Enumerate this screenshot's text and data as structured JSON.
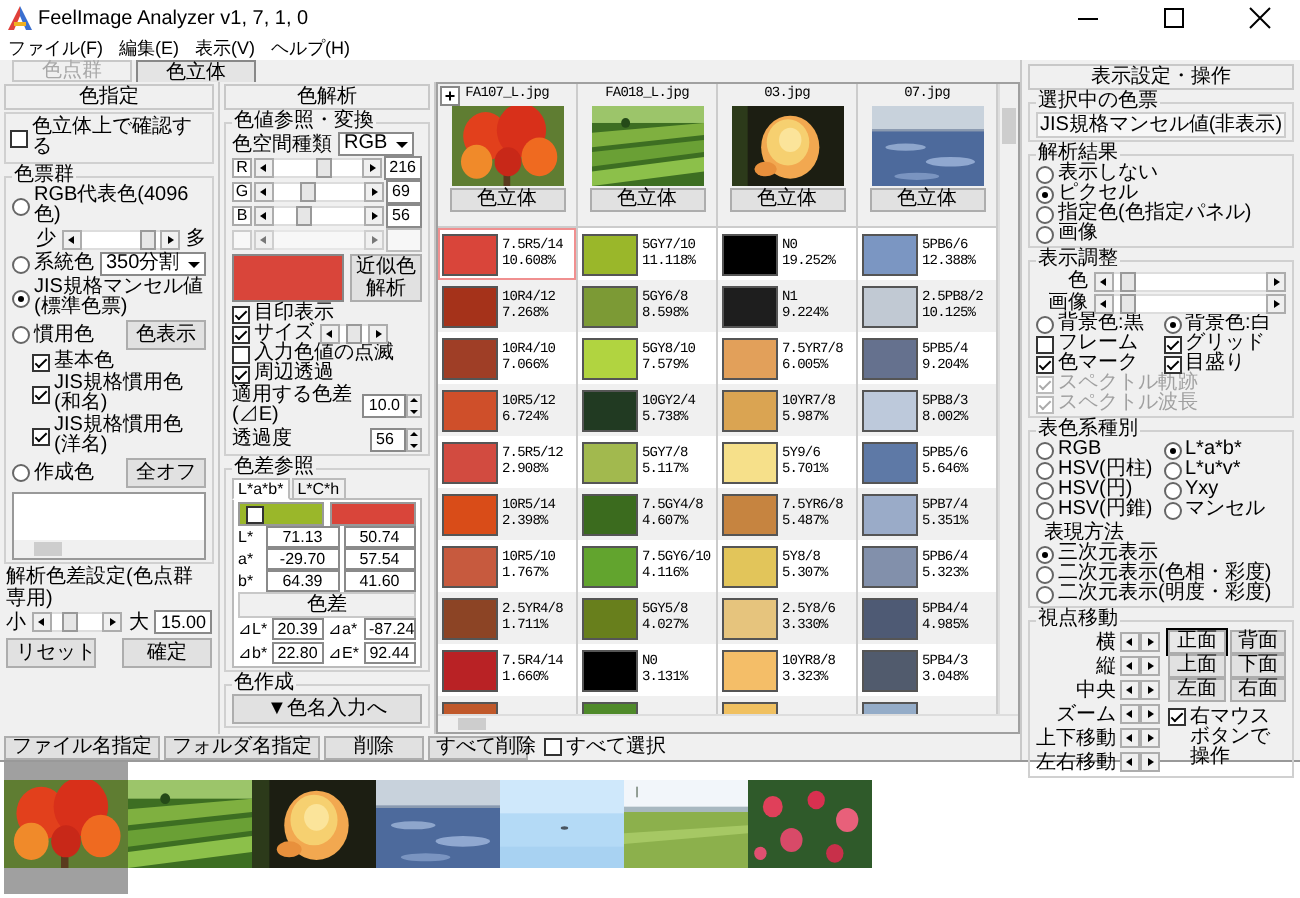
{
  "window": {
    "title": "FeelImage Analyzer v1, 7, 1, 0"
  },
  "menu": [
    "ファイル(F)",
    "編集(E)",
    "表示(V)",
    "ヘルプ(H)"
  ],
  "tabs": [
    {
      "label": "色点群",
      "selected": false,
      "disabled": true
    },
    {
      "label": "色立体",
      "selected": true,
      "disabled": false
    }
  ],
  "color_spec_panel": {
    "title": "色指定",
    "confirm_on_solid": {
      "label": "色立体上で確認する",
      "checked": false
    },
    "swatch_group": {
      "title": "色票群",
      "items": [
        {
          "kind": "radio-slider",
          "label": "RGB代表色(4096色)",
          "selected": false,
          "min_label": "少",
          "max_label": "多",
          "level": 0.92
        },
        {
          "kind": "radio-dropdown",
          "label": "系統色",
          "selected": false,
          "value": "350分割"
        },
        {
          "kind": "radio",
          "label": "JIS規格マンセル値(標準色票)",
          "selected": true
        },
        {
          "kind": "radio-button",
          "label": "慣用色",
          "selected": false,
          "button": "色表示"
        },
        {
          "kind": "checkbox",
          "label": "基本色",
          "checked": true
        },
        {
          "kind": "checkbox",
          "label": "JIS規格慣用色(和名)",
          "checked": true
        },
        {
          "kind": "checkbox",
          "label": "JIS規格慣用色(洋名)",
          "checked": true
        },
        {
          "kind": "radio-button",
          "label": "作成色",
          "selected": false,
          "button": "全オフ"
        }
      ]
    },
    "delta_setting": {
      "title": "解析色差設定(色点群専用)",
      "min_label": "小",
      "max_label": "大",
      "level": 0.3,
      "value": "15.00"
    },
    "buttons": [
      "リセット",
      "確定"
    ]
  },
  "analysis_panel": {
    "title": "色解析",
    "convert_group": {
      "title": "色値参照・変換",
      "space_label": "色空間種類",
      "space": "RGB",
      "channels": [
        {
          "name": "R",
          "level": 0.6,
          "value": "216"
        },
        {
          "name": "G",
          "level": 0.35,
          "value": "69"
        },
        {
          "name": "B",
          "level": 0.3,
          "value": "56"
        }
      ],
      "swatch": {
        "color": "#d9453a"
      },
      "analyze_button": "近似色解析",
      "options": [
        {
          "kind": "checkbox",
          "label": "目印表示",
          "checked": true
        },
        {
          "kind": "checkbox-slider",
          "label": "サイズ",
          "checked": true,
          "level": 0.45
        },
        {
          "kind": "checkbox",
          "label": "入力色値の点滅",
          "checked": false
        },
        {
          "kind": "checkbox",
          "label": "周辺透過",
          "checked": true
        },
        {
          "kind": "spinner",
          "label": "適用する色差(⊿E)",
          "value": "10.0"
        },
        {
          "kind": "spinner",
          "label": "透過度",
          "value": "56"
        }
      ]
    },
    "diff_group": {
      "title": "色差参照",
      "tabs": [
        {
          "label": "L*a*b*",
          "selected": true
        },
        {
          "label": "L*C*h",
          "selected": false
        }
      ],
      "swatches": [
        {
          "color": "#9ab72a",
          "checked": false
        },
        {
          "color": "#d9453a"
        }
      ],
      "rows": [
        {
          "label": "L*",
          "values": [
            "71.13",
            "50.74"
          ]
        },
        {
          "label": "a*",
          "values": [
            "-29.70",
            "57.54"
          ]
        },
        {
          "label": "b*",
          "values": [
            "64.39",
            "41.60"
          ]
        }
      ],
      "diff_title": "色差",
      "diffs": [
        {
          "label": "⊿L*",
          "value": "20.39"
        },
        {
          "label": "⊿a*",
          "value": "-87.24"
        },
        {
          "label": "⊿b*",
          "value": "22.80"
        },
        {
          "label": "⊿E*",
          "value": "92.44"
        }
      ]
    },
    "create_group": {
      "title": "色作成",
      "button": "▼色名入力へ"
    }
  },
  "grid": {
    "expand_button": "+",
    "columns": [
      {
        "file": "FA107_L.jpg",
        "button": "色立体",
        "cells": [
          {
            "color": "#d9453a",
            "label": "7.5R5/14",
            "percent": "10.608%",
            "selected": true
          },
          {
            "color": "#a5321a",
            "label": "10R4/12",
            "percent": "7.268%",
            "selected": false
          },
          {
            "color": "#9f3e26",
            "label": "10R4/10",
            "percent": "7.066%",
            "selected": false
          },
          {
            "color": "#cf4f2a",
            "label": "10R5/12",
            "percent": "6.724%",
            "selected": false
          },
          {
            "color": "#d24b40",
            "label": "7.5R5/12",
            "percent": "2.908%",
            "selected": false
          },
          {
            "color": "#d94c18",
            "label": "10R5/14",
            "percent": "2.398%",
            "selected": false
          },
          {
            "color": "#c75a3e",
            "label": "10R5/10",
            "percent": "1.767%",
            "selected": false
          },
          {
            "color": "#8c4425",
            "label": "2.5YR4/8",
            "percent": "1.711%",
            "selected": false
          },
          {
            "color": "#b92225",
            "label": "7.5R4/14",
            "percent": "1.660%",
            "selected": false
          },
          {
            "color": "#c0582a",
            "selected": false
          }
        ]
      },
      {
        "file": "FA018_L.jpg",
        "button": "色立体",
        "cells": [
          {
            "color": "#9ab72a",
            "label": "5GY7/10",
            "percent": "11.118%",
            "selected": false
          },
          {
            "color": "#7c9a35",
            "label": "5GY6/8",
            "percent": "8.598%",
            "selected": false
          },
          {
            "color": "#b1d440",
            "label": "5GY8/10",
            "percent": "7.579%",
            "selected": false
          },
          {
            "color": "#213a22",
            "label": "10GY2/4",
            "percent": "5.738%",
            "selected": false
          },
          {
            "color": "#a2b94e",
            "label": "5GY7/8",
            "percent": "5.117%",
            "selected": false
          },
          {
            "color": "#3b6b1e",
            "label": "7.5GY4/8",
            "percent": "4.607%",
            "selected": false
          },
          {
            "color": "#62a42e",
            "label": "7.5GY6/10",
            "percent": "4.116%",
            "selected": false
          },
          {
            "color": "#687f1c",
            "label": "5GY5/8",
            "percent": "4.027%",
            "selected": false
          },
          {
            "color": "#000000",
            "label": "N0",
            "percent": "3.131%",
            "selected": false
          },
          {
            "color": "#4f8a2a",
            "selected": false
          }
        ]
      },
      {
        "file": "03.jpg",
        "button": "色立体",
        "cells": [
          {
            "color": "#000000",
            "label": "N0",
            "percent": "19.252%",
            "selected": false
          },
          {
            "color": "#1e1e1e",
            "label": "N1",
            "percent": "9.224%",
            "selected": false
          },
          {
            "color": "#e2a05a",
            "label": "7.5YR7/8",
            "percent": "6.005%",
            "selected": false
          },
          {
            "color": "#daa452",
            "label": "10YR7/8",
            "percent": "5.987%",
            "selected": false
          },
          {
            "color": "#f6e08a",
            "label": "5Y9/6",
            "percent": "5.701%",
            "selected": false
          },
          {
            "color": "#c68440",
            "label": "7.5YR6/8",
            "percent": "5.487%",
            "selected": false
          },
          {
            "color": "#e2c55a",
            "label": "5Y8/8",
            "percent": "5.307%",
            "selected": false
          },
          {
            "color": "#e6c47d",
            "label": "2.5Y8/6",
            "percent": "3.330%",
            "selected": false
          },
          {
            "color": "#f4be68",
            "label": "10YR8/8",
            "percent": "3.323%",
            "selected": false
          },
          {
            "color": "#f0c060",
            "selected": false
          }
        ]
      },
      {
        "file": "07.jpg",
        "button": "色立体",
        "cells": [
          {
            "color": "#7b96c2",
            "label": "5PB6/6",
            "percent": "12.388%",
            "selected": false
          },
          {
            "color": "#c1c9d3",
            "label": "2.5PB8/2",
            "percent": "10.125%",
            "selected": false
          },
          {
            "color": "#65718e",
            "label": "5PB5/4",
            "percent": "9.204%",
            "selected": false
          },
          {
            "color": "#bdc9db",
            "label": "5PB8/3",
            "percent": "8.002%",
            "selected": false
          },
          {
            "color": "#5e79a6",
            "label": "5PB5/6",
            "percent": "5.646%",
            "selected": false
          },
          {
            "color": "#9aabc8",
            "label": "5PB7/4",
            "percent": "5.351%",
            "selected": false
          },
          {
            "color": "#8290ab",
            "label": "5PB6/4",
            "percent": "5.323%",
            "selected": false
          },
          {
            "color": "#4e5a74",
            "label": "5PB4/4",
            "percent": "4.985%",
            "selected": false
          },
          {
            "color": "#515b6d",
            "label": "5PB4/3",
            "percent": "3.048%",
            "selected": false
          },
          {
            "color": "#94acc8",
            "selected": false
          }
        ]
      }
    ]
  },
  "display_panel": {
    "title": "表示設定・操作",
    "current_group": {
      "title": "選択中の色票",
      "value": "JIS規格マンセル値(非表示)"
    },
    "result_group": {
      "title": "解析結果",
      "options": [
        {
          "label": "表示しない",
          "selected": false
        },
        {
          "label": "ピクセル",
          "selected": true
        },
        {
          "label": "指定色(色指定パネル)",
          "selected": false
        },
        {
          "label": "画像",
          "selected": false
        }
      ]
    },
    "adjust_group": {
      "title": "表示調整",
      "sliders": [
        {
          "label": "色",
          "level": 0.05
        },
        {
          "label": "画像",
          "level": 0.05
        }
      ],
      "backgrounds": [
        {
          "label": "背景色:黒",
          "selected": false
        },
        {
          "label": "背景色:白",
          "selected": true
        }
      ],
      "checks": [
        {
          "label": "フレーム",
          "checked": false,
          "disabled": false
        },
        {
          "label": "グリッド",
          "checked": true,
          "disabled": false
        },
        {
          "label": "色マーク",
          "checked": true,
          "disabled": false
        },
        {
          "label": "目盛り",
          "checked": true,
          "disabled": false
        },
        {
          "label": "スペクトル軌跡",
          "checked": true,
          "disabled": true
        },
        {
          "label": "スペクトル波長",
          "checked": true,
          "disabled": true
        }
      ]
    },
    "system_group": {
      "title": "表色系種別",
      "systems": [
        {
          "label": "RGB",
          "selected": false
        },
        {
          "label": "L*a*b*",
          "selected": true
        },
        {
          "label": "HSV(円柱)",
          "selected": false
        },
        {
          "label": "L*u*v*",
          "selected": false
        },
        {
          "label": "HSV(円)",
          "selected": false
        },
        {
          "label": "Yxy",
          "selected": false
        },
        {
          "label": "HSV(円錐)",
          "selected": false
        },
        {
          "label": "マンセル",
          "selected": false
        }
      ],
      "mode_title": "表現方法",
      "modes": [
        {
          "label": "三次元表示",
          "selected": true
        },
        {
          "label": "二次元表示(色相・彩度)",
          "selected": false
        },
        {
          "label": "二次元表示(明度・彩度)",
          "selected": false
        }
      ]
    },
    "view_group": {
      "title": "視点移動",
      "controls": [
        "横",
        "縦",
        "中央",
        "ズーム",
        "上下移動",
        "左右移動"
      ],
      "faces": [
        {
          "label": "正面",
          "selected": true
        },
        {
          "label": "背面",
          "selected": false
        },
        {
          "label": "上面",
          "selected": false
        },
        {
          "label": "下面",
          "selected": false
        },
        {
          "label": "左面",
          "selected": false
        },
        {
          "label": "右面",
          "selected": false
        }
      ],
      "right_mouse": {
        "label": "右マウスボタンで操作",
        "checked": true
      }
    }
  },
  "toolbar": {
    "buttons": [
      "ファイル名指定",
      "フォルダ名指定",
      "削除",
      "すべて削除"
    ],
    "select_all": {
      "label": "すべて選択",
      "checked": false
    }
  },
  "thumbnails": [
    {
      "kind": "picture",
      "selected": true
    },
    {
      "kind": "picture",
      "selected": false
    },
    {
      "kind": "picture",
      "selected": false
    },
    {
      "kind": "picture",
      "selected": false
    },
    {
      "kind": "picture",
      "selected": false
    },
    {
      "kind": "picture",
      "selected": false
    },
    {
      "kind": "picture",
      "selected": false
    }
  ]
}
